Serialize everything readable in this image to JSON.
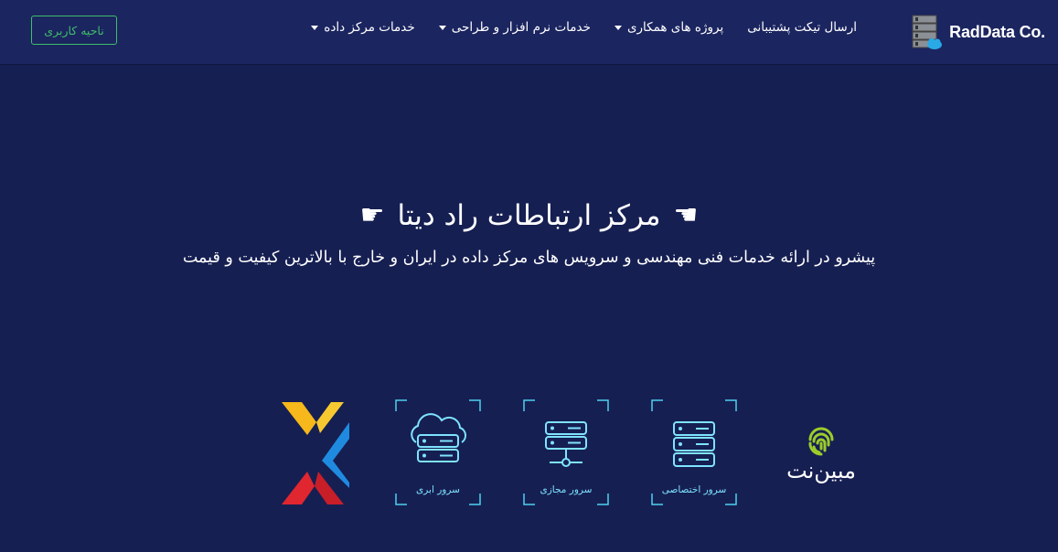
{
  "navbar": {
    "brand": "RadData Co.",
    "menu": [
      {
        "label": "خدمات مرکز داده",
        "dropdown": true
      },
      {
        "label": "خدمات نرم افزار و طراحی",
        "dropdown": true
      },
      {
        "label": "پروژه های همکاری",
        "dropdown": true
      },
      {
        "label": "ارسال تیکت پشتیبانی",
        "dropdown": false
      }
    ],
    "login_button": "ناحیه کاربری"
  },
  "hero": {
    "title": "مرکز ارتباطات راد دیتا",
    "subtitle": "پیشرو در ارائه خدمات فنی مهندسی و سرویس های مرکز داده در ایران و خارج با بالاترین کیفیت و قیمت"
  },
  "services": [
    {
      "label": "سرور اختصاصی",
      "icon": "dedicated-server-icon"
    },
    {
      "label": "سرور مجازی",
      "icon": "virtual-server-icon"
    },
    {
      "label": "سرور ابری",
      "icon": "cloud-server-icon"
    }
  ],
  "partners": {
    "mobinnet": "مبین‌نت"
  },
  "colors": {
    "background": "#161f52",
    "navbar": "#1b2560",
    "accent_green": "#3fbf6a",
    "service_cyan": "#7ee3ff"
  }
}
